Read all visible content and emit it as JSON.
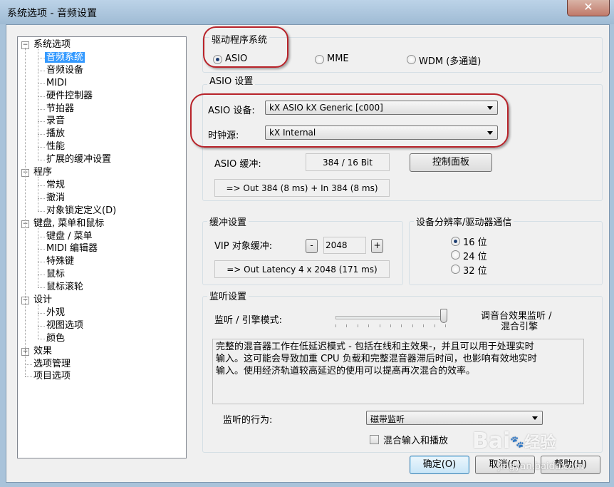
{
  "window": {
    "title": "系统选项 - 音频设置",
    "close_glyph": "✕"
  },
  "tree": [
    {
      "label": "系统选项",
      "level": 0,
      "expander": "−"
    },
    {
      "label": "音频系统",
      "level": 1,
      "selected": true
    },
    {
      "label": "音频设备",
      "level": 1
    },
    {
      "label": "MIDI",
      "level": 1
    },
    {
      "label": "硬件控制器",
      "level": 1
    },
    {
      "label": "节拍器",
      "level": 1
    },
    {
      "label": "录音",
      "level": 1
    },
    {
      "label": "播放",
      "level": 1
    },
    {
      "label": "性能",
      "level": 1
    },
    {
      "label": "扩展的缓冲设置",
      "level": 1
    },
    {
      "label": "程序",
      "level": 0,
      "expander": "−"
    },
    {
      "label": "常规",
      "level": 1
    },
    {
      "label": "撤消",
      "level": 1
    },
    {
      "label": "对象锁定定义(D)",
      "level": 1
    },
    {
      "label": "键盘, 菜单和鼠标",
      "level": 0,
      "expander": "−"
    },
    {
      "label": "键盘 / 菜单",
      "level": 1
    },
    {
      "label": "MIDI 编辑器",
      "level": 1
    },
    {
      "label": "特殊键",
      "level": 1
    },
    {
      "label": "鼠标",
      "level": 1
    },
    {
      "label": "鼠标滚轮",
      "level": 1
    },
    {
      "label": "设计",
      "level": 0,
      "expander": "−"
    },
    {
      "label": "外观",
      "level": 1
    },
    {
      "label": "视图选项",
      "level": 1
    },
    {
      "label": "颜色",
      "level": 1
    },
    {
      "label": "效果",
      "level": 0,
      "expander": "+"
    },
    {
      "label": "选项管理",
      "level": 0
    },
    {
      "label": "项目选项",
      "level": 0
    }
  ],
  "driver": {
    "group_label": "驱动程序系统",
    "options": [
      {
        "label": "ASIO",
        "checked": true
      },
      {
        "label": "MME",
        "checked": false
      },
      {
        "label": "WDM (多通道)",
        "checked": false
      }
    ]
  },
  "asio": {
    "group_label": "ASIO 设置",
    "device_label": "ASIO 设备:",
    "device_value": "kX ASIO kX Generic [c000]",
    "clock_label": "时钟源:",
    "clock_value": "kX Internal",
    "buffer_label": "ASIO 缓冲:",
    "buffer_value": "384 / 16 Bit",
    "control_panel_label": "控制面板",
    "latency_text": "=> Out 384 (8 ms) + In 384 (8 ms)"
  },
  "buffer": {
    "group_label": "缓冲设置",
    "vip_label": "VIP 对象缓冲:",
    "minus": "-",
    "value": "2048",
    "plus": "+",
    "latency_text": "=> Out Latency 4 x 2048 (171 ms)"
  },
  "resolution": {
    "group_label": "设备分辨率/驱动器通信",
    "options": [
      {
        "label": "16 位",
        "checked": true
      },
      {
        "label": "24 位",
        "checked": false
      },
      {
        "label": "32 位",
        "checked": false
      }
    ]
  },
  "monitor": {
    "group_label": "监听设置",
    "engine_label": "监听 / 引擎模式:",
    "slider_right_line1": "调音台效果监听 /",
    "slider_right_line2": "混合引擎",
    "slider_position": 0.99,
    "description_line1": "完整的混音器工作在低延迟模式 - 包括在线和主效果-，并且可以用于处理实时",
    "description_line2": "输入。这可能会导致加重 CPU 负载和完整混音器滞后时间，也影响有效地实时",
    "description_line3": "输入。使用经济轨道较高延迟的使用可以提高再次混合的效率。",
    "behavior_label": "监听的行为:",
    "behavior_value": "磁带监听",
    "mix_label": "混合输入和播放",
    "mix_checked": false
  },
  "buttons": {
    "ok": "确定(O)",
    "cancel": "取消(C)",
    "help": "帮助(H)"
  },
  "watermark": {
    "brand": "Bai",
    "brand2": "经验",
    "url": "jingyan.baidu.com"
  }
}
